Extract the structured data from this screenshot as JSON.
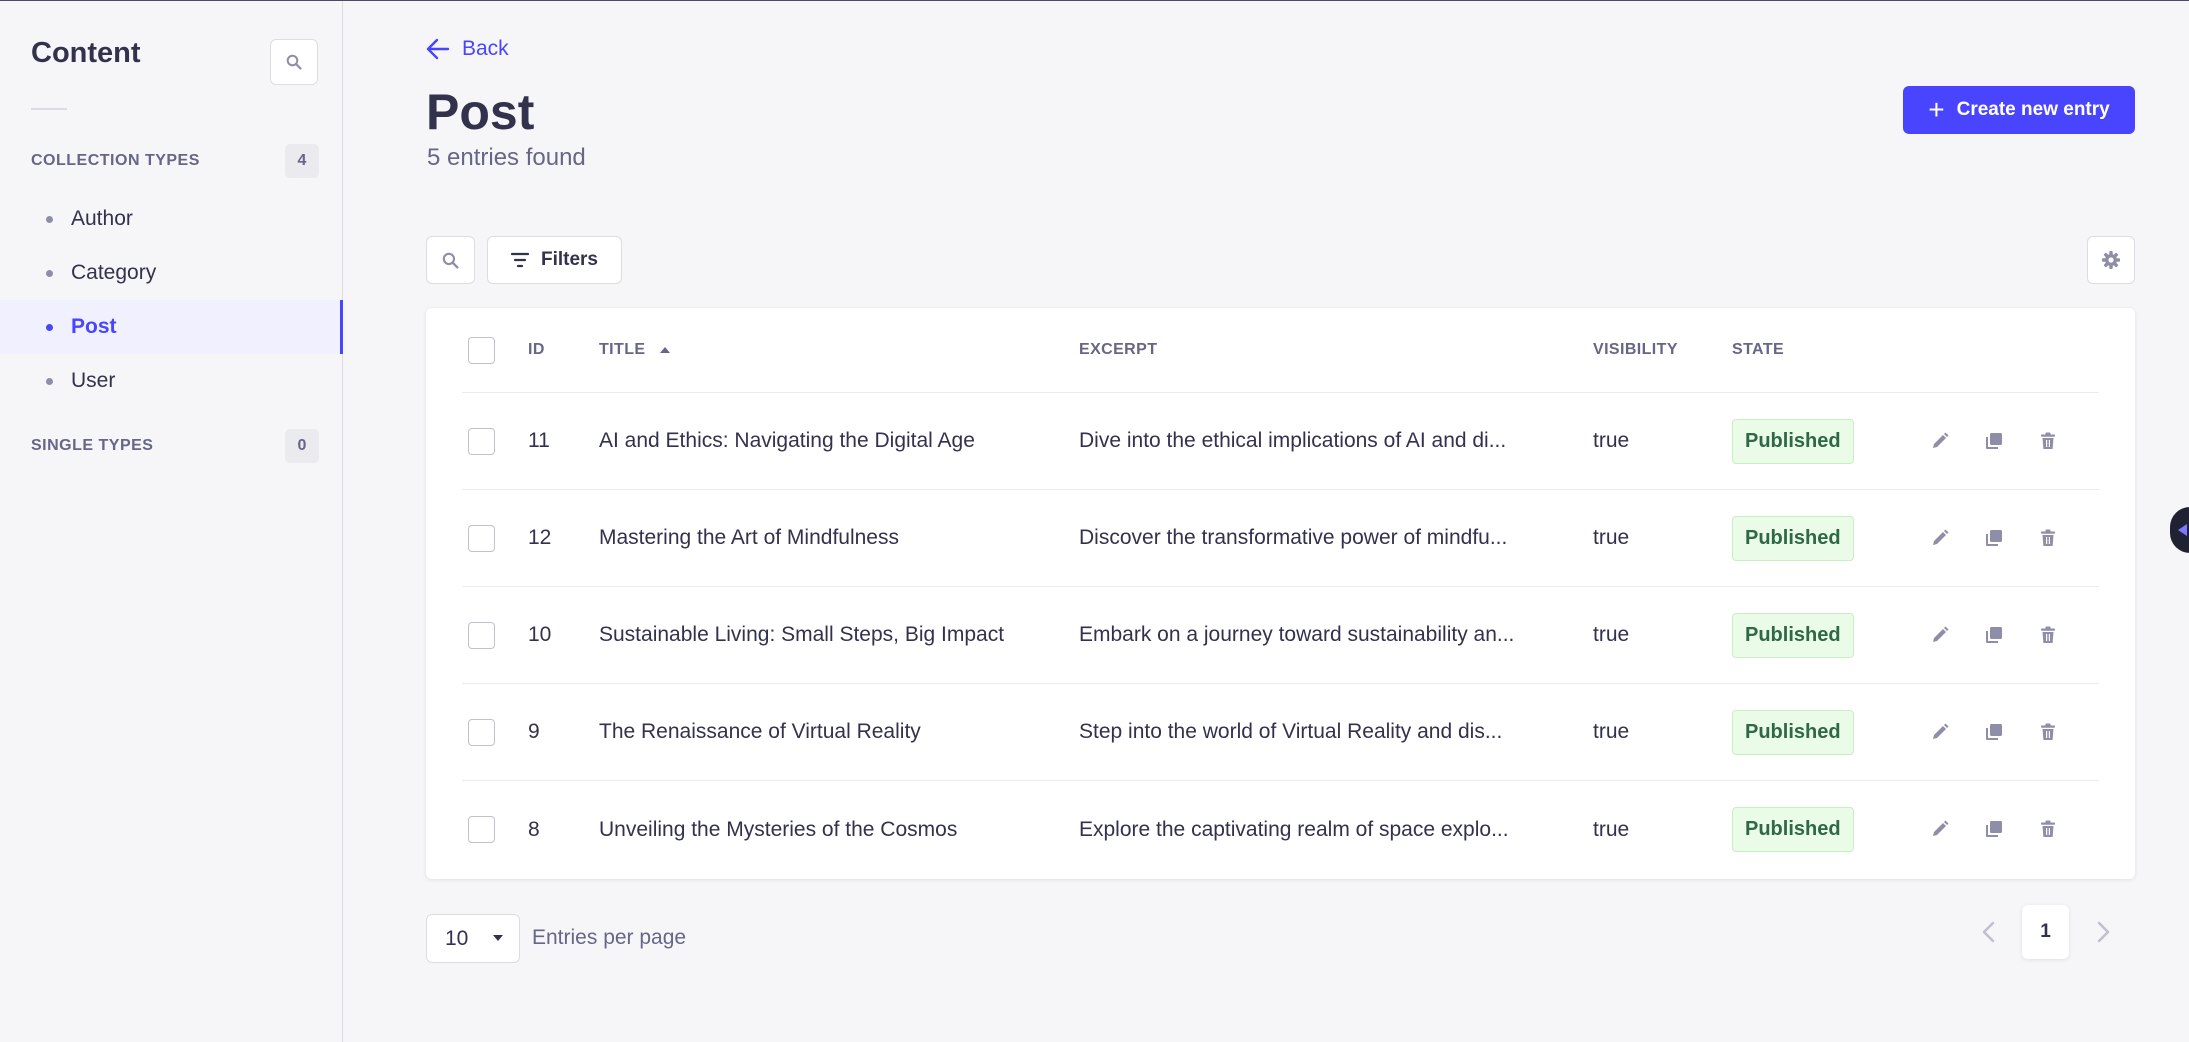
{
  "sidebar": {
    "title": "Content",
    "collection_types": {
      "label": "COLLECTION TYPES",
      "count": "4"
    },
    "items": [
      {
        "label": "Author"
      },
      {
        "label": "Category"
      },
      {
        "label": "Post"
      },
      {
        "label": "User"
      }
    ],
    "single_types": {
      "label": "SINGLE TYPES",
      "count": "0"
    }
  },
  "header": {
    "back_label": "Back",
    "title": "Post",
    "subtitle": "5 entries found",
    "create_label": "Create new entry"
  },
  "toolbar": {
    "filters_label": "Filters"
  },
  "table": {
    "columns": {
      "id": "ID",
      "title": "TITLE",
      "excerpt": "EXCERPT",
      "visibility": "VISIBILITY",
      "state": "STATE"
    },
    "rows": [
      {
        "id": "11",
        "title": "AI and Ethics: Navigating the Digital Age",
        "excerpt": "Dive into the ethical implications of AI and di...",
        "visibility": "true",
        "state": "Published"
      },
      {
        "id": "12",
        "title": "Mastering the Art of Mindfulness",
        "excerpt": "Discover the transformative power of mindfu...",
        "visibility": "true",
        "state": "Published"
      },
      {
        "id": "10",
        "title": "Sustainable Living: Small Steps, Big Impact",
        "excerpt": "Embark on a journey toward sustainability an...",
        "visibility": "true",
        "state": "Published"
      },
      {
        "id": "9",
        "title": "The Renaissance of Virtual Reality",
        "excerpt": "Step into the world of Virtual Reality and dis...",
        "visibility": "true",
        "state": "Published"
      },
      {
        "id": "8",
        "title": "Unveiling the Mysteries of the Cosmos",
        "excerpt": "Explore the captivating realm of space explo...",
        "visibility": "true",
        "state": "Published"
      }
    ]
  },
  "footer": {
    "per_page_value": "10",
    "per_page_label": "Entries per page",
    "current_page": "1"
  },
  "colors": {
    "accent": "#4945ff",
    "published_bg": "#eafbe7",
    "published_text": "#2f6846"
  },
  "icons": [
    "search-icon",
    "arrow-left-icon",
    "plus-icon",
    "filter-icon",
    "gear-icon",
    "sort-up-icon",
    "pencil-icon",
    "duplicate-icon",
    "trash-icon",
    "chevron-left-icon",
    "chevron-right-icon"
  ]
}
